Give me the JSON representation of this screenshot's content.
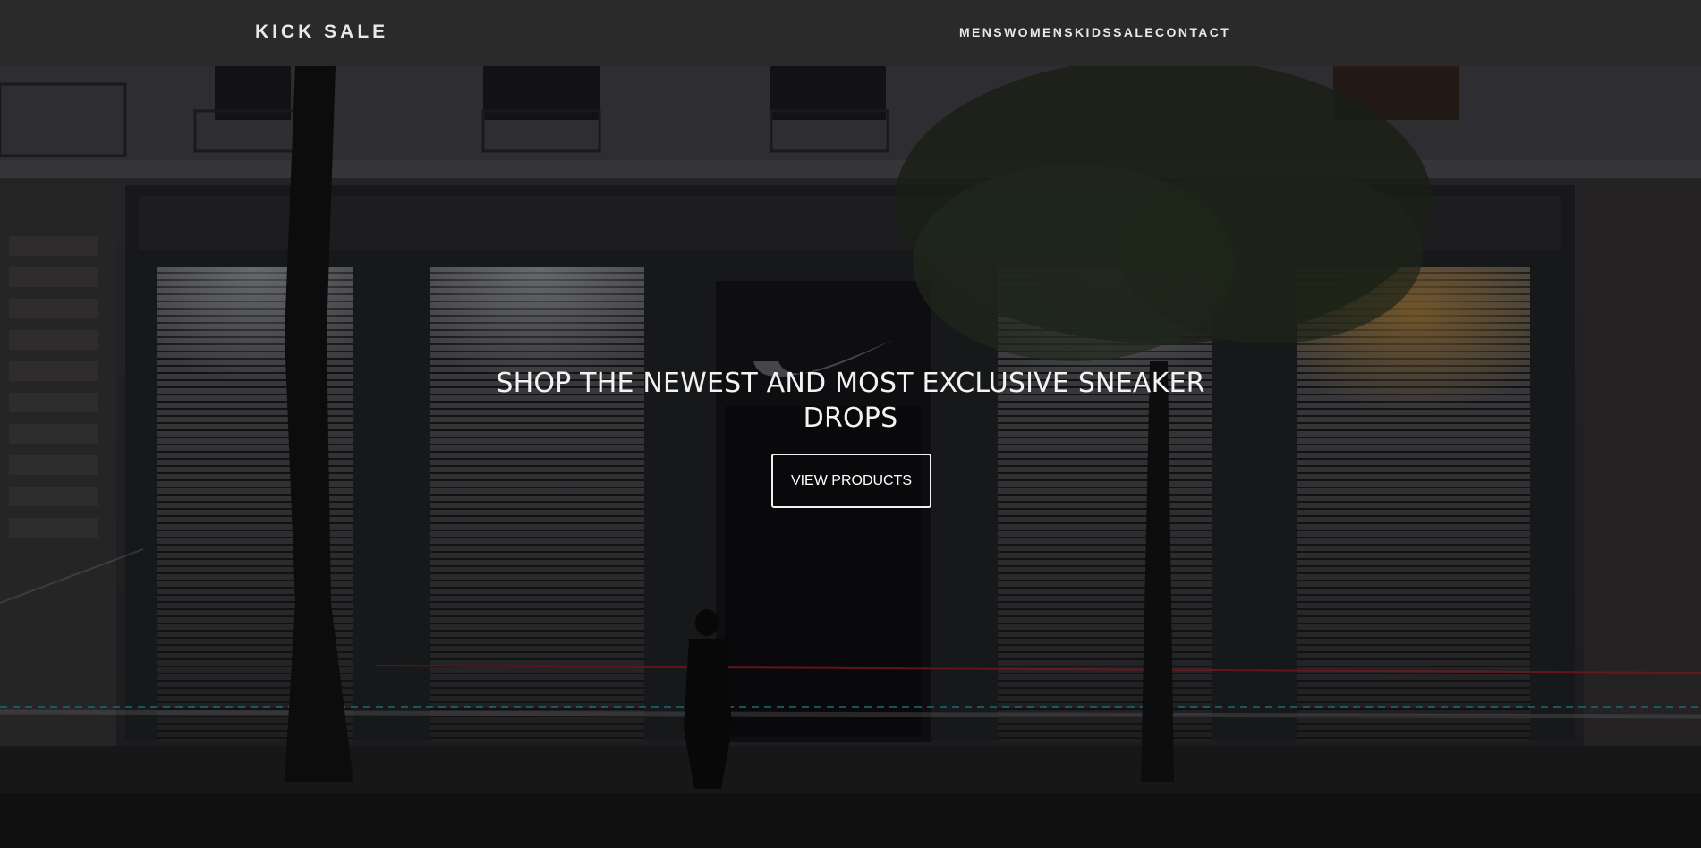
{
  "nav": {
    "brand": "KICK SALE",
    "links": [
      "MENS",
      "WOMENS",
      "KIDS",
      "SALE",
      "CONTACT"
    ]
  },
  "hero": {
    "headline": "SHOP THE NEWEST AND MOST EXCLUSIVE SNEAKER DROPS",
    "cta_label": "VIEW PRODUCTS"
  },
  "colors": {
    "navbar_bg": "#2a2a2a",
    "nav_text": "#e9e9e9",
    "hero_text": "#f2f2f2",
    "button_border": "#f0f0f0",
    "light_trail_red": "#c2232d",
    "light_trail_cyan": "#2aa6b8"
  }
}
